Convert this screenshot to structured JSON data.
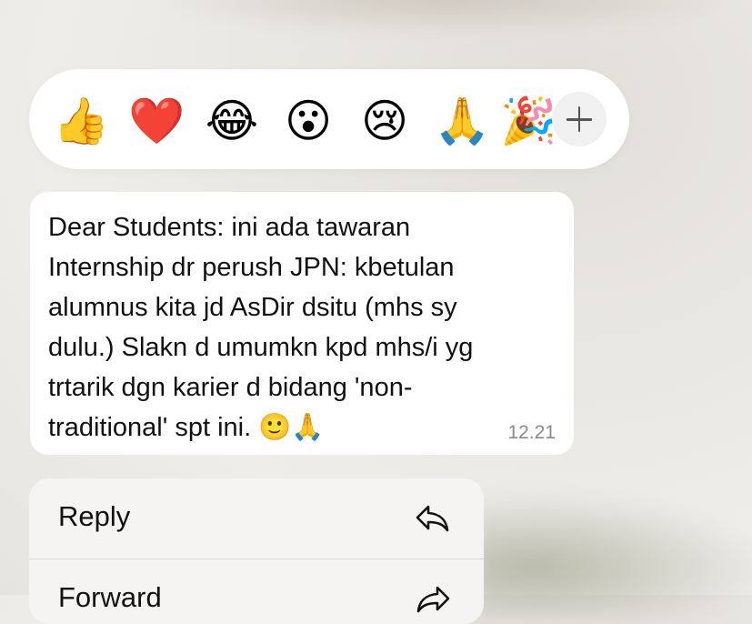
{
  "reactions": {
    "emojis": [
      "👍",
      "❤️",
      "😂",
      "😮",
      "😢",
      "🙏",
      "🎉"
    ],
    "icons": [
      "thumbs-up-icon",
      "heart-icon",
      "tears-of-joy-icon",
      "surprised-icon",
      "crying-icon",
      "praying-hands-icon",
      "party-popper-icon",
      "plus-icon"
    ]
  },
  "message": {
    "text": "Dear Students: ini ada tawaran\nInternship dr perush JPN: kbetulan\nalumnus kita jd AsDir dsitu (mhs sy\ndulu.) Slakn d umumkn kpd mhs/i yg\ntrtarik dgn karier d bidang 'non-\ntraditional' spt ini. 🙂🙏",
    "time": "12.21"
  },
  "menu": {
    "reply_label": "Reply",
    "forward_label": "Forward"
  },
  "colors": {
    "bubble": "#ffffff",
    "menu": "#f5f4f2",
    "time": "#8a8a8a"
  }
}
